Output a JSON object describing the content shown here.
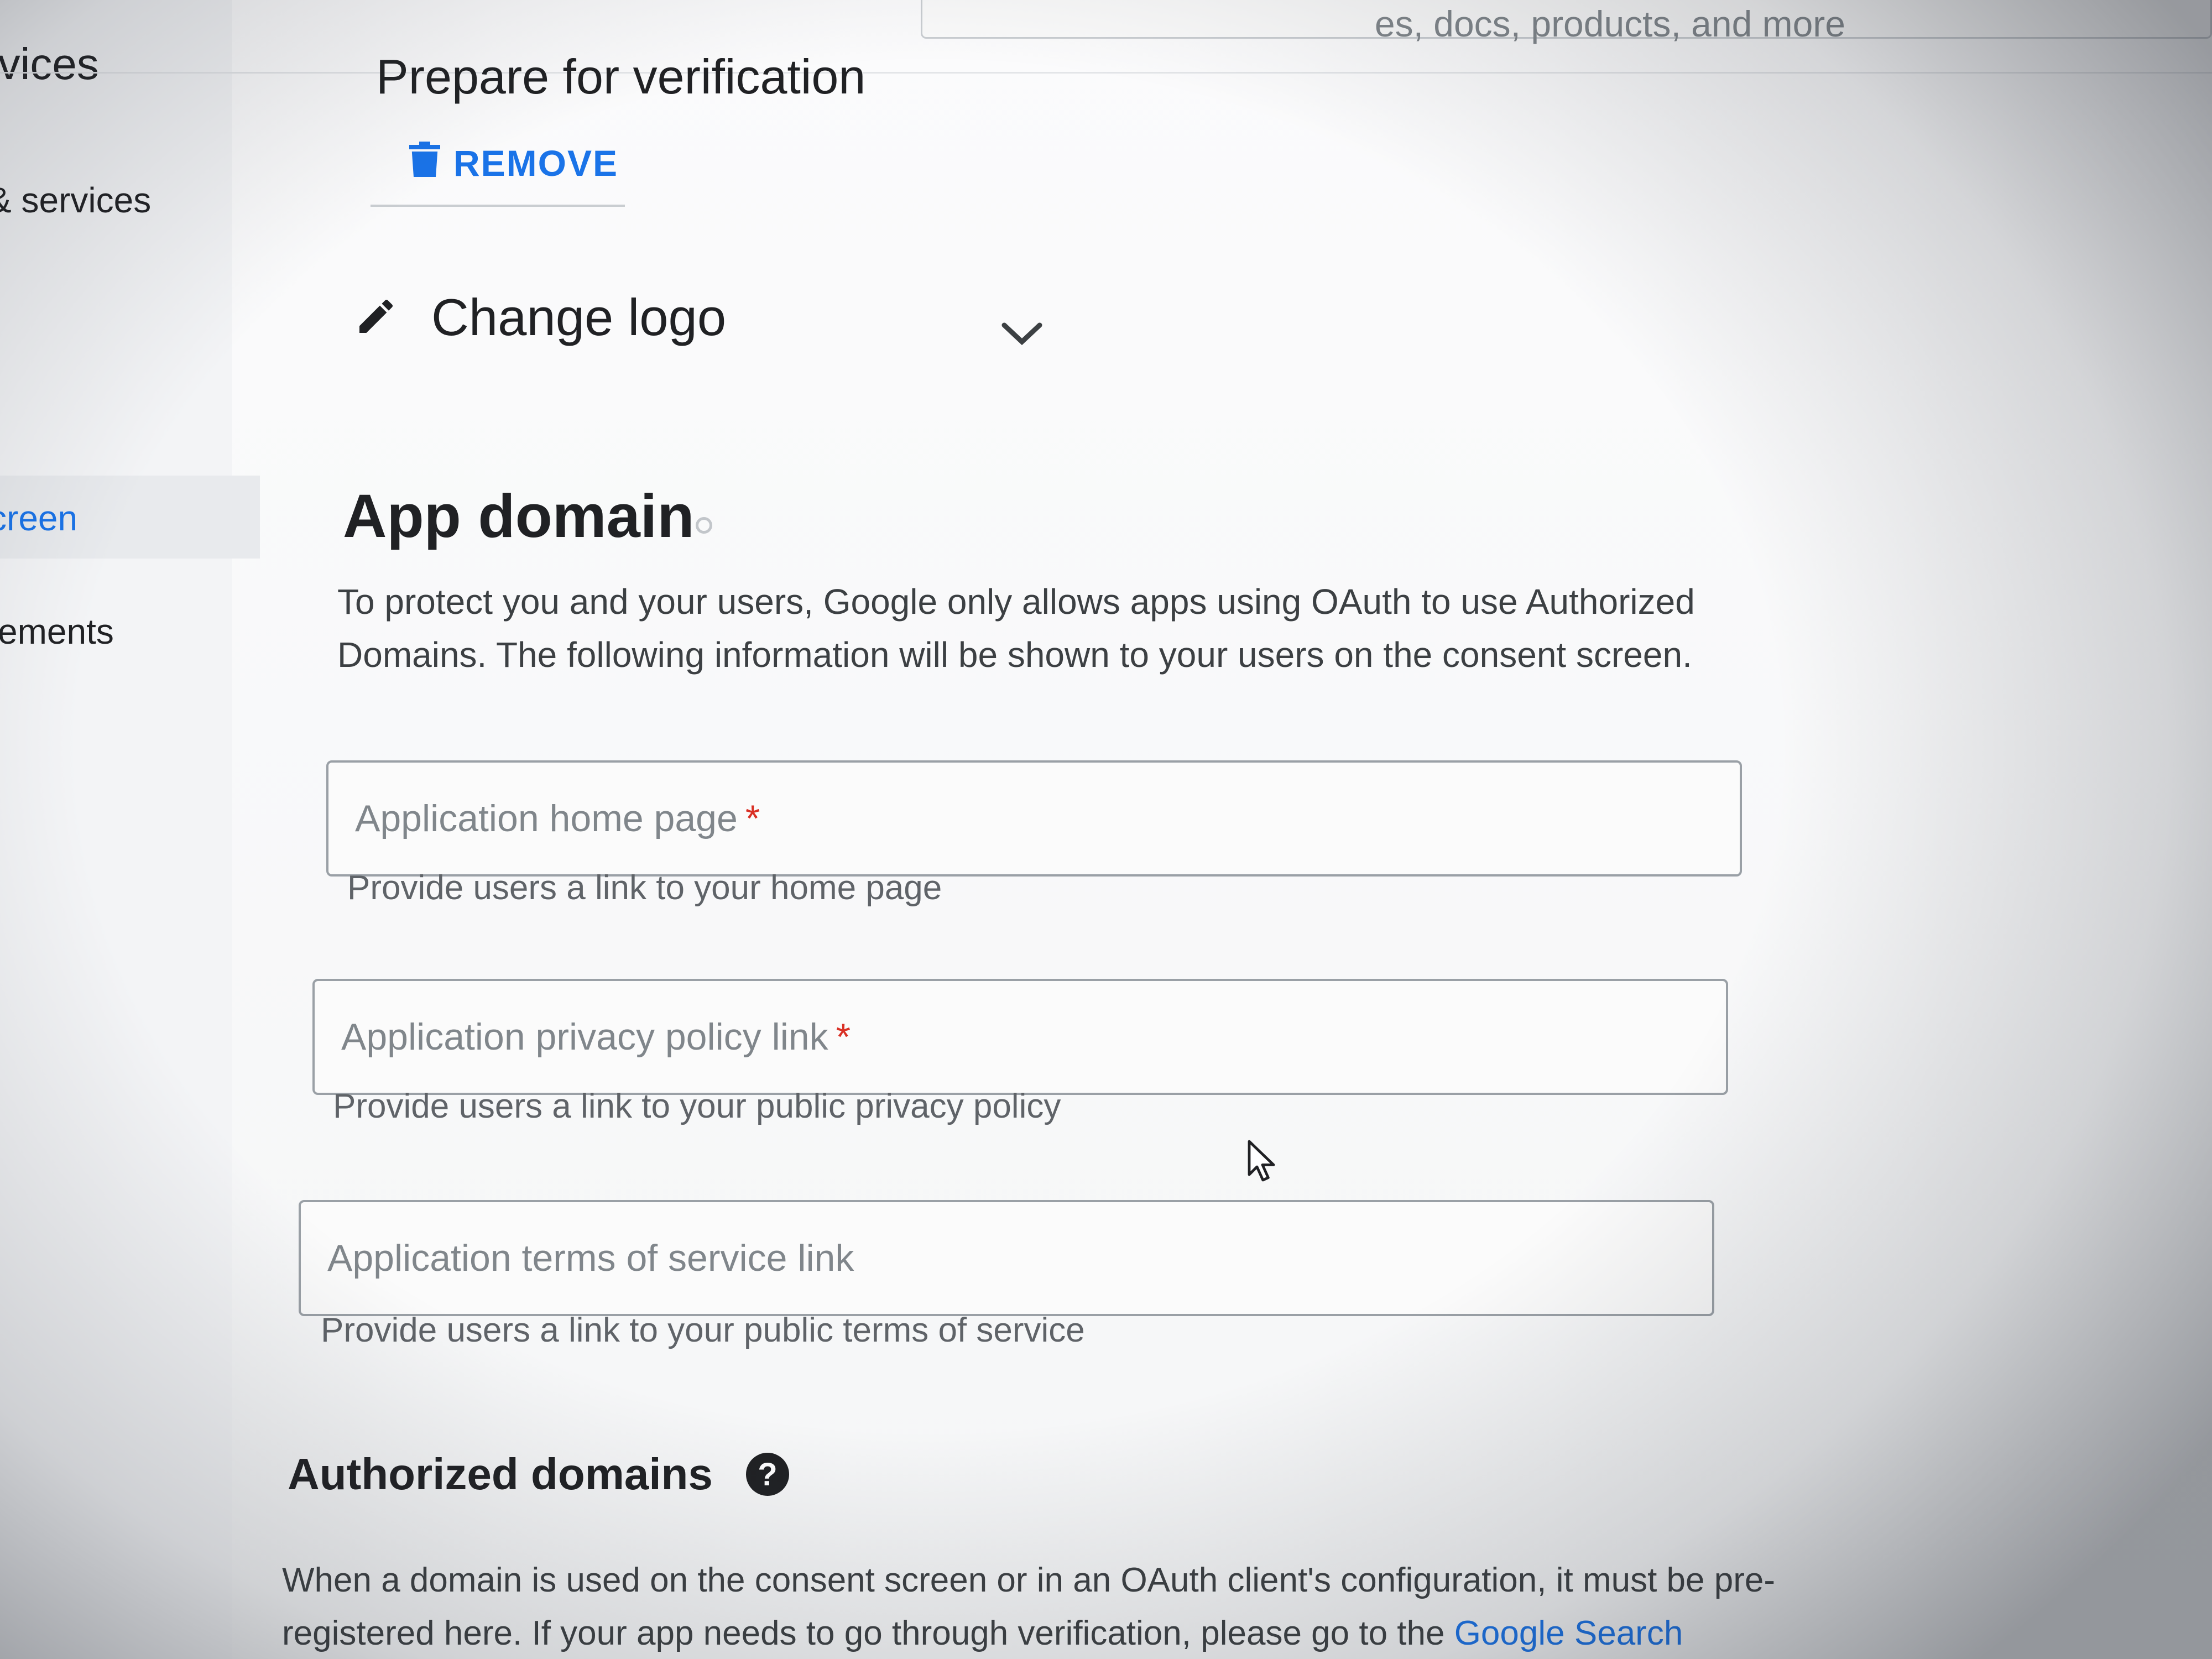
{
  "search": {
    "placeholder_tail": "es, docs, products, and more"
  },
  "sidebar": {
    "items": [
      {
        "label": "rvices"
      },
      {
        "label": "& services"
      },
      {
        "label": "creen"
      },
      {
        "label": "ements"
      }
    ]
  },
  "verification": {
    "title": "Prepare for verification",
    "remove_label": "REMOVE",
    "change_logo_label": "Change logo"
  },
  "app_domain": {
    "heading": "App domain",
    "description": "To protect you and your users, Google only allows apps using OAuth to use Authorized Domains. The following information will be shown to your users on the consent screen.",
    "fields": [
      {
        "label": "Application home page",
        "required": "*",
        "hint": "Provide users a link to your home page"
      },
      {
        "label": "Application privacy policy link",
        "required": "*",
        "hint": "Provide users a link to your public privacy policy"
      },
      {
        "label": "Application terms of service link",
        "required": "",
        "hint": "Provide users a link to your public terms of service"
      }
    ]
  },
  "authorized_domains": {
    "heading": "Authorized domains",
    "description": "When a domain is used on the consent screen or in an OAuth client's configuration, it must be pre-registered here. If your app needs to go through verification, please go to the",
    "link_text": "Google Search"
  },
  "colors": {
    "accent": "#1a73e8",
    "required": "#d93025",
    "text": "#202124",
    "hint": "#5f6368"
  },
  "icons": [
    "trash-icon",
    "pencil-icon",
    "chevron-down-icon",
    "help-icon",
    "mouse-pointer-icon"
  ]
}
